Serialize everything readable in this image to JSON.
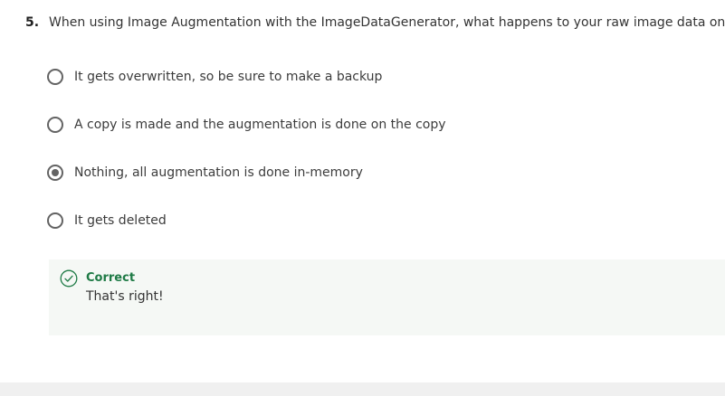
{
  "question": {
    "number": "5.",
    "text": "When using Image Augmentation with the ImageDataGenerator, what happens to your raw image data on-disk."
  },
  "options": [
    {
      "label": "It gets overwritten, so be sure to make a backup",
      "selected": false
    },
    {
      "label": "A copy is made and the augmentation is done on the copy",
      "selected": false
    },
    {
      "label": "Nothing, all augmentation is done in-memory",
      "selected": true
    },
    {
      "label": "It gets deleted",
      "selected": false
    }
  ],
  "feedback": {
    "icon": "check-circle-icon",
    "status": "Correct",
    "message": "That's right!",
    "color": "#1e7a45",
    "background": "#f5f8f5"
  }
}
